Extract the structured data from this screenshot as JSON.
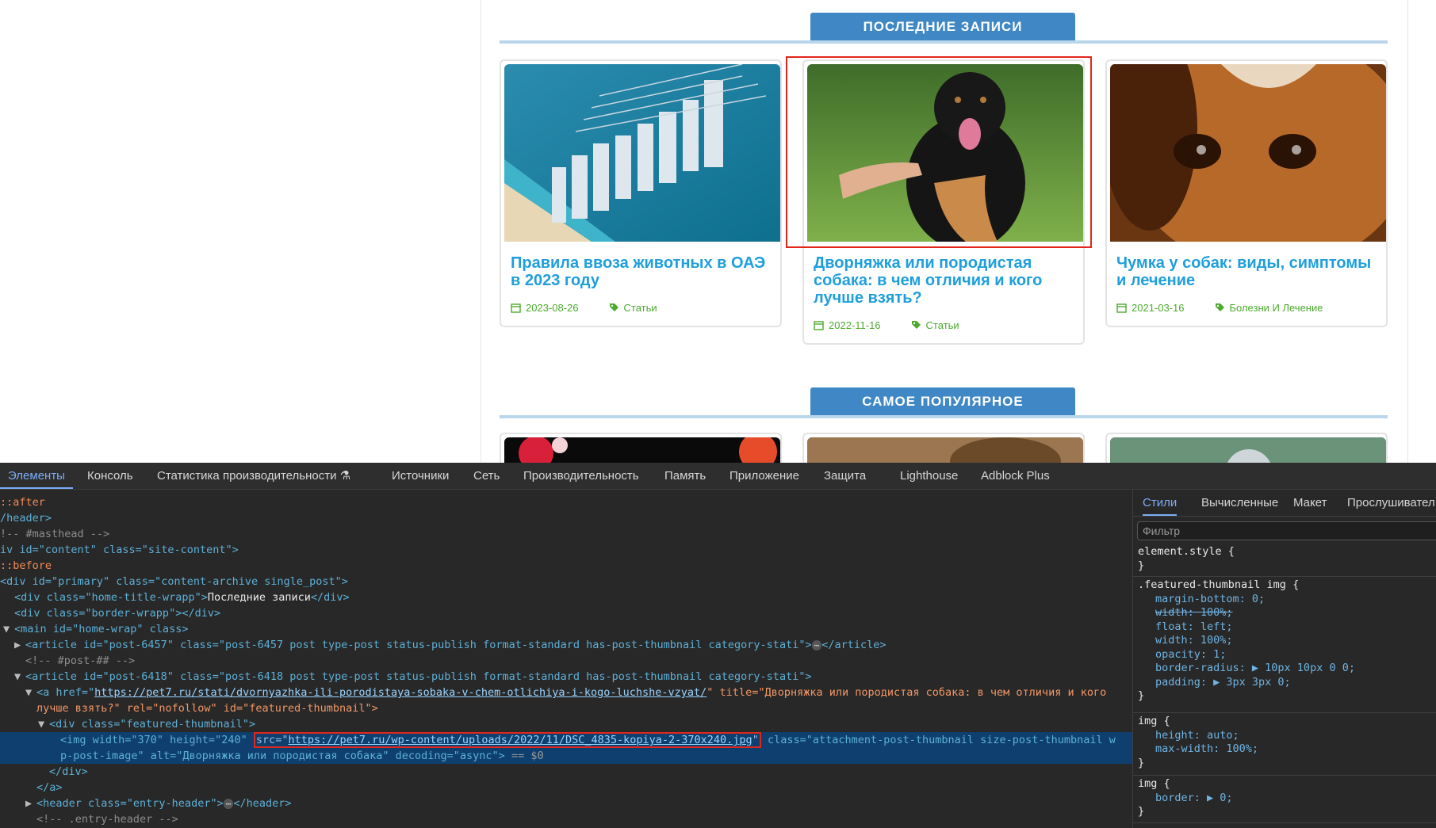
{
  "page": {
    "sections": [
      {
        "title": "ПОСЛЕДНИЕ ЗАПИСИ"
      },
      {
        "title": "САМОЕ ПОПУЛЯРНОЕ"
      }
    ],
    "posts": [
      {
        "title": "Правила ввоза животных в ОАЭ в 2023 году",
        "date": "2023-08-26",
        "category": "Статьи"
      },
      {
        "title": "Дворняжка или породистая собака: в чем отличия и кого лучше взять?",
        "date": "2022-11-16",
        "category": "Статьи"
      },
      {
        "title": "Чумка у собак: виды, симптомы и лечение",
        "date": "2021-03-16",
        "category": "Болезни И Лечение"
      }
    ]
  },
  "devtools": {
    "tabs": [
      "Элементы",
      "Консоль",
      "Статистика производительности",
      "Источники",
      "Сеть",
      "Производительность",
      "Память",
      "Приложение",
      "Защита",
      "Lighthouse",
      "Adblock Plus"
    ],
    "dom": {
      "after": "::after",
      "header_close": "/header>",
      "masthead_comment": "!-- #masthead -->",
      "content_div": "iv id=\"content\" class=\"site-content\">",
      "before": "::before",
      "primary_div": "<div id=\"primary\" class=\"content-archive single_post\">",
      "home_title_open": "<div class=\"home-title-wrapp\">",
      "home_title_text": "Последние записи",
      "div_close": "</div>",
      "border_wrapp": "<div class=\"border-wrapp\"></div>",
      "main_open": "<main id=\"home-wrap\" class>",
      "article1": "<article id=\"post-6457\" class=\"post-6457 post type-post status-publish format-standard has-post-thumbnail category-stati\">",
      "article_close": "</article>",
      "post_comment": "<!-- #post-## -->",
      "article2": "<article id=\"post-6418\" class=\"post-6418 post type-post status-publish format-standard has-post-thumbnail category-stati\">",
      "a_open": "<a href=\"",
      "a_href": "https://pet7.ru/stati/dvornyazhka-ili-porodistaya-sobaka-v-chem-otlichiya-i-kogo-luchshe-vzyat/",
      "a_title_part1": "\" title=\"Дворняжка или породистая собака: в чем отличия и кого",
      "a_title_part2": "лучше взять?\" rel=\"nofollow\" id=\"featured-thumbnail\">",
      "ft_div": "<div class=\"featured-thumbnail\">",
      "img_open": "<img width=\"370\" height=\"240\" ",
      "img_src_pre": "src=\"",
      "img_src": "https://pet7.ru/wp-content/uploads/2022/11/DSC_4835-kopiya-2-370x240.jpg",
      "img_src_post": "\"",
      "img_rest1": " class=\"attachment-post-thumbnail size-post-thumbnail w",
      "img_rest2": "p-post-image\" alt=\"Дворняжка или породистая собака\" decoding=\"async\">",
      "img_marker": " == $0",
      "div_close2": "</div>",
      "a_close": "</a>",
      "header_entry": "<header class=\"entry-header\">",
      "header_close2": "</header>",
      "entry_comment": "<!-- .entry-header -->"
    },
    "styles": {
      "tabs": [
        "Стили",
        "Вычисленные",
        "Макет",
        "Прослушивател"
      ],
      "filter_placeholder": "Фильтр",
      "rules": {
        "r1_sel": "element.style {",
        "r1_close": "}",
        "r2_sel": ".featured-thumbnail img {",
        "r2_p1": "margin-bottom: 0;",
        "r2_p2": "width: 100%;",
        "r2_p3": "float: left;",
        "r2_p4": "width: 100%;",
        "r2_p5": "opacity: 1;",
        "r2_p6": "border-radius: ▶ 10px 10px 0 0;",
        "r2_p7": "padding: ▶ 3px 3px 0;",
        "r2_close": "}",
        "r3_sel": "img {",
        "r3_p1": "height: auto;",
        "r3_p2": "max-width: 100%;",
        "r3_close": "}",
        "r4_sel": "img {",
        "r4_p1": "border: ▶ 0;",
        "r4_close": "}"
      }
    }
  }
}
